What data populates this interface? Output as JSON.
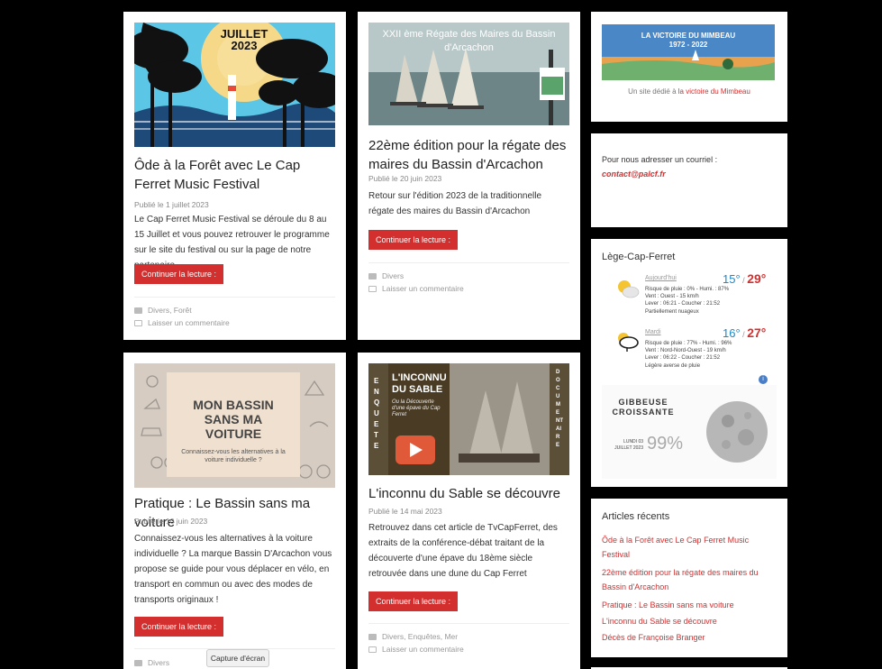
{
  "posts": [
    {
      "image_text": "JUILLET 2023",
      "title": "Ôde à la Forêt avec Le Cap Ferret Music Festival",
      "date": "Publié le 1 juillet 2023",
      "excerpt": "Le Cap Ferret Music Festival se déroule du 8 au 15 Juillet et vous pouvez retrouver le programme sur le site du festival ou sur la page de notre partenaire",
      "button": "Continuer la lecture :",
      "categories": "Divers, Forêt",
      "comment": "Laisser un commentaire"
    },
    {
      "image_text": "XXII ème Régate des Maires du Bassin d'Arcachon",
      "title": "22ème édition pour la régate des maires du Bassin d'Arcachon",
      "date": "Publié le 20 juin 2023",
      "excerpt": "Retour sur l'édition 2023 de la traditionnelle régate des maires du Bassin d'Arcachon",
      "button": "Continuer la lecture :",
      "categories": "Divers",
      "comment": "Laisser un commentaire"
    },
    {
      "image_title": "MON BASSIN SANS MA VOITURE",
      "image_sub": "Connaissez-vous les alternatives à la voiture individuelle ?",
      "title": "Pratique : Le Bassin sans ma voiture",
      "date": "Publié le 10 juin 2023",
      "excerpt": "Connaissez-vous les alternatives à la voiture individuelle ? La marque Bassin D'Arcachon vous propose se guide pour vous déplacer en vélo, en transport en commun ou avec des modes de transports originaux !",
      "button": "Continuer la lecture :",
      "categories": "Divers"
    },
    {
      "image_title": "L'INCONNU DU SABLE",
      "image_sub": "Ou la Découverte d'une épave du Cap Ferret",
      "image_left": "ENQUETE",
      "image_right": "DOCUMENTAIRE",
      "title": "L'inconnu du Sable se découvre",
      "date": "Publié le 14 mai 2023",
      "excerpt": "Retrouvez dans cet article de TvCapFerret, des extraits de la conférence-débat traitant de la découverte d'une épave du 18ème siècle retrouvée dans une dune du Cap Ferret",
      "button": "Continuer la lecture :",
      "categories": "Divers, Enquêtes, Mer",
      "comment": "Laisser un commentaire"
    }
  ],
  "victoire": {
    "banner_title": "LA VICTOIRE DU MIMBEAU",
    "banner_years": "1972 - 2022",
    "caption_prefix": "Un site dédié à",
    "caption_link": "la victoire du Mimbeau"
  },
  "contact": {
    "label": "Pour nous adresser un courriel :",
    "email": "contact@palcf.fr"
  },
  "weather": {
    "city": "Lège-Cap-Ferret",
    "days": [
      {
        "day": "Aujourd'hui",
        "min": "15°",
        "sep": " / ",
        "max": "29°",
        "line1": "Risque de pluie : 0% - Humi. : 87%",
        "line2": "Vent : Ouest - 15 km/h",
        "line3": "Lever : 06:21 - Coucher : 21:52",
        "desc": "Partiellement nuageux"
      },
      {
        "day": "Mardi",
        "min": "16°",
        "sep": " / ",
        "max": "27°",
        "line1": "Risque de pluie : 77% - Humi. : 96%",
        "line2": "Vent : Nord-Nord-Ouest - 19 km/h",
        "line3": "Lever : 06:22 - Coucher : 21:52",
        "desc": "Légère averse de pluie"
      }
    ],
    "moon_phase": "GIBBEUSE CROISSANTE",
    "moon_date": "LUNDI 03 JUILLET 2023",
    "moon_pct": "99%"
  },
  "recent": {
    "title": "Articles récents",
    "items": [
      "Ôde à la Forêt avec Le Cap Ferret Music Festival",
      "22ème édition pour la régate des maires du Bassin d'Arcachon",
      "Pratique : Le Bassin sans ma voiture",
      "L'inconnu du Sable se découvre",
      "Décès de Françoise Branger"
    ]
  },
  "tooltip": "Capture d'écran",
  "colors": {
    "accent": "#d32f2f",
    "background": "#000000"
  }
}
